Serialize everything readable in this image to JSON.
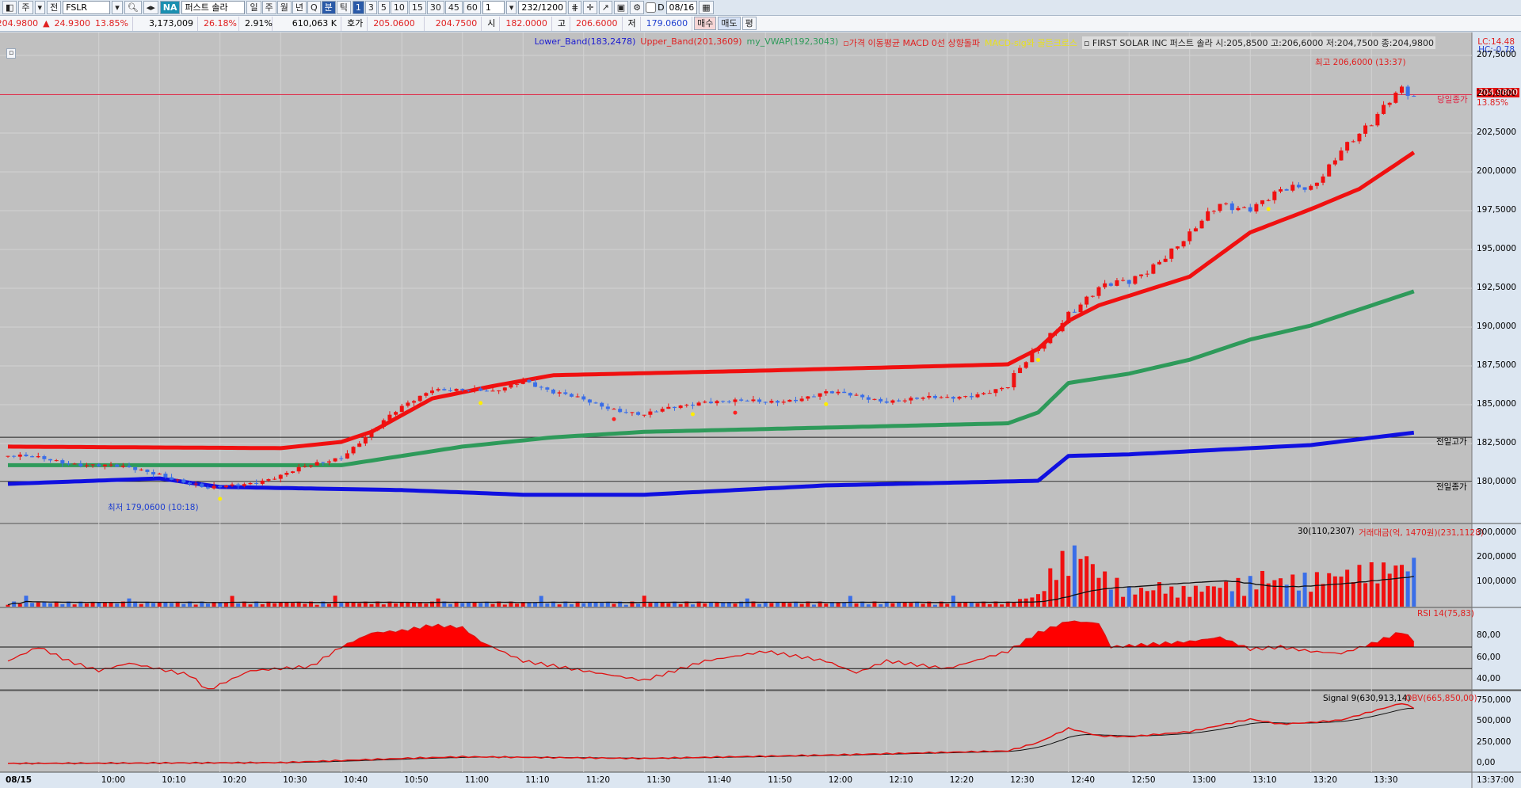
{
  "toolbar": {
    "type": "주",
    "jeon": "전",
    "symbol": "FSLR",
    "na": "NA",
    "name": "퍼스트 솔라",
    "periods": [
      "일",
      "주",
      "월",
      "년",
      "Q",
      "분",
      "틱"
    ],
    "active_period": "분",
    "intervals": [
      "1",
      "3",
      "5",
      "10",
      "15",
      "30",
      "45",
      "60"
    ],
    "active_interval": "1",
    "multiplier": "1",
    "count": "232",
    "count_max": "/1200",
    "checkbox_label": "D",
    "date": "08/16"
  },
  "quote": {
    "price": "204.9800",
    "arrow": "▲",
    "change": "24.9300",
    "pct": "13.85%",
    "volume": "3,173,009",
    "vol_pct": "26.18%",
    "turnover": "2.91%",
    "amount": "610,063 K",
    "hoga_label": "호가",
    "bid": "205.0600",
    "ask": "204.7500",
    "open_label": "시",
    "open": "182.0000",
    "high_label": "고",
    "high": "206.6000",
    "low_label": "저",
    "low": "179.0600",
    "buy": "매수",
    "sell": "매도",
    "pyeong": "평"
  },
  "legend": [
    {
      "text": "Lower_Band(183,2478)",
      "color": "#1a1ad0"
    },
    {
      "text": "Upper_Band(201,3609)",
      "color": "#e02020"
    },
    {
      "text": "my_VWAP(192,3043)",
      "color": "#2e9a5a"
    },
    {
      "text": "▫가격 이동평균 MACD 0선 상향돌파",
      "color": "#e02020"
    },
    {
      "text": "MACD-sig와 골든크로스",
      "color": "#e8e020"
    },
    {
      "text": "▫ FIRST SOLAR INC  퍼스트 솔라 시:205,8500 고:206,6000 저:204,7500 종:204,9800",
      "color": "#222222"
    }
  ],
  "lc": "LC:14.48",
  "hc": "HC:-0.78",
  "annotations": {
    "high": "최고 206,6000 (13:37)",
    "low": "최저 179,0600 (10:18)",
    "today_close": "당일종가",
    "today_pct": "13.85%",
    "price_tag": "204.9800",
    "prev_high": "전일고가",
    "prev_close": "전일종가"
  },
  "volume_panel": {
    "ma_label": "30(110,2307)",
    "label": "거래대금(억, 1470원)(231,1128)",
    "ticks": [
      "300,0000",
      "200,0000",
      "100,0000"
    ]
  },
  "rsi_panel": {
    "label": "RSI 14(75,83)",
    "ticks": [
      "80,00",
      "60,00",
      "40,00"
    ]
  },
  "obv_panel": {
    "signal_label": "Signal 9(630,913,14)",
    "label": "OBV(665,850,00)",
    "ticks": [
      "750,000",
      "500,000",
      "250,000",
      "0,00"
    ]
  },
  "time_axis": {
    "date": "08/15",
    "ticks": [
      "10:00",
      "10:10",
      "10:20",
      "10:30",
      "10:40",
      "10:50",
      "11:00",
      "11:10",
      "11:20",
      "11:30",
      "11:40",
      "11:50",
      "12:00",
      "12:10",
      "12:20",
      "12:30",
      "12:40",
      "12:50",
      "13:00",
      "13:10",
      "13:20",
      "13:30"
    ],
    "end": "13:37:00"
  },
  "colors": {
    "up": "#f01010",
    "down": "#3a6ee8",
    "upper": "#f01010",
    "vwap": "#2e9a5a",
    "lower": "#1010e0"
  },
  "chart_data": {
    "type": "candlestick",
    "symbol": "FSLR",
    "interval": "1min",
    "start": "09:45",
    "end": "13:37",
    "price_ticks": [
      207.5,
      205,
      202.5,
      200,
      197.5,
      195,
      192.5,
      190,
      187.5,
      185,
      182.5,
      180
    ],
    "current_price": 204.98,
    "prev_high": 182.9,
    "prev_close": 180.05,
    "close": [
      [
        0,
        181.7
      ],
      [
        15,
        181.1
      ],
      [
        25,
        180.6
      ],
      [
        33,
        179.5
      ],
      [
        45,
        180.4
      ],
      [
        55,
        181.7
      ],
      [
        60,
        183.25
      ],
      [
        65,
        184.8
      ],
      [
        70,
        186.1
      ],
      [
        80,
        185.75
      ],
      [
        85,
        186.7
      ],
      [
        90,
        185.75
      ],
      [
        105,
        184.3
      ],
      [
        115,
        185.3
      ],
      [
        125,
        185.1
      ],
      [
        135,
        185.75
      ],
      [
        145,
        185.3
      ],
      [
        155,
        185.4
      ],
      [
        165,
        186.1
      ],
      [
        170,
        188.6
      ],
      [
        175,
        191.1
      ],
      [
        180,
        192.3
      ],
      [
        185,
        192.9
      ],
      [
        190,
        194.5
      ],
      [
        195,
        195.75
      ],
      [
        200,
        197.9
      ],
      [
        205,
        197.9
      ],
      [
        210,
        198.6
      ],
      [
        215,
        198.9
      ],
      [
        220,
        201.7
      ],
      [
        225,
        202.9
      ],
      [
        230,
        205.4
      ],
      [
        232,
        205.0
      ]
    ],
    "upper_band": [
      [
        0,
        182.3
      ],
      [
        45,
        182.2
      ],
      [
        55,
        182.6
      ],
      [
        60,
        183.25
      ],
      [
        70,
        185.4
      ],
      [
        80,
        186.2
      ],
      [
        90,
        186.9
      ],
      [
        125,
        187.2
      ],
      [
        165,
        187.6
      ],
      [
        170,
        188.6
      ],
      [
        175,
        190.4
      ],
      [
        180,
        191.4
      ],
      [
        195,
        193.25
      ],
      [
        205,
        196.1
      ],
      [
        215,
        197.6
      ],
      [
        223,
        198.9
      ],
      [
        232,
        201.25
      ]
    ],
    "vwap": [
      [
        0,
        181.1
      ],
      [
        55,
        181.1
      ],
      [
        65,
        181.7
      ],
      [
        75,
        182.3
      ],
      [
        90,
        182.9
      ],
      [
        105,
        183.25
      ],
      [
        165,
        183.8
      ],
      [
        170,
        184.5
      ],
      [
        175,
        186.4
      ],
      [
        185,
        187.0
      ],
      [
        195,
        187.9
      ],
      [
        205,
        189.2
      ],
      [
        215,
        190.1
      ],
      [
        232,
        192.3
      ]
    ],
    "lower_band": [
      [
        0,
        179.9
      ],
      [
        25,
        180.25
      ],
      [
        35,
        179.7
      ],
      [
        65,
        179.5
      ],
      [
        85,
        179.2
      ],
      [
        105,
        179.2
      ],
      [
        135,
        179.8
      ],
      [
        170,
        180.1
      ],
      [
        175,
        181.7
      ],
      [
        185,
        181.8
      ],
      [
        205,
        182.2
      ],
      [
        215,
        182.4
      ],
      [
        232,
        183.2
      ]
    ],
    "volume_level": [
      [
        0,
        15
      ],
      [
        165,
        15
      ],
      [
        170,
        40
      ],
      [
        173,
        150
      ],
      [
        177,
        200
      ],
      [
        180,
        120
      ],
      [
        185,
        60
      ],
      [
        195,
        60
      ],
      [
        205,
        90
      ],
      [
        215,
        100
      ],
      [
        232,
        150
      ]
    ],
    "rsi": [
      [
        0,
        57
      ],
      [
        5,
        70
      ],
      [
        10,
        57
      ],
      [
        15,
        48
      ],
      [
        20,
        55
      ],
      [
        30,
        44
      ],
      [
        33,
        30
      ],
      [
        40,
        48
      ],
      [
        50,
        52
      ],
      [
        55,
        70
      ],
      [
        60,
        83
      ],
      [
        65,
        85
      ],
      [
        70,
        90
      ],
      [
        75,
        88
      ],
      [
        78,
        75
      ],
      [
        85,
        57
      ],
      [
        95,
        48
      ],
      [
        105,
        39
      ],
      [
        115,
        57
      ],
      [
        125,
        66
      ],
      [
        135,
        57
      ],
      [
        140,
        46
      ],
      [
        145,
        57
      ],
      [
        155,
        50
      ],
      [
        165,
        66
      ],
      [
        170,
        83
      ],
      [
        175,
        94
      ],
      [
        180,
        92
      ],
      [
        182,
        70
      ],
      [
        190,
        73
      ],
      [
        195,
        75
      ],
      [
        200,
        79
      ],
      [
        205,
        68
      ],
      [
        210,
        70
      ],
      [
        215,
        66
      ],
      [
        220,
        64
      ],
      [
        225,
        73
      ],
      [
        230,
        84
      ],
      [
        232,
        76
      ]
    ],
    "rsi_levels": [
      70,
      50
    ],
    "obv": [
      [
        0,
        0
      ],
      [
        45,
        10
      ],
      [
        65,
        60
      ],
      [
        75,
        80
      ],
      [
        105,
        60
      ],
      [
        135,
        100
      ],
      [
        165,
        150
      ],
      [
        170,
        250
      ],
      [
        175,
        420
      ],
      [
        180,
        330
      ],
      [
        185,
        320
      ],
      [
        195,
        380
      ],
      [
        205,
        530
      ],
      [
        210,
        470
      ],
      [
        215,
        490
      ],
      [
        220,
        520
      ],
      [
        225,
        620
      ],
      [
        230,
        720
      ],
      [
        232,
        666
      ]
    ]
  }
}
